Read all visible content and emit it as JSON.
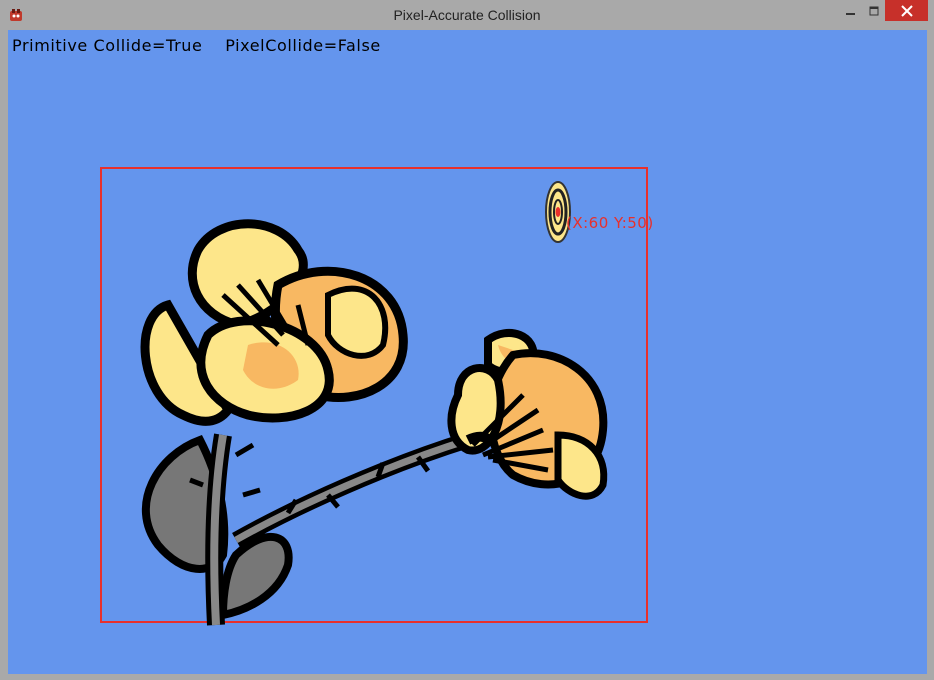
{
  "window": {
    "title": "Pixel-Accurate Collision",
    "titlebar_color": "#a9a9a9",
    "close_button_color": "#c7302a"
  },
  "canvas": {
    "background": "#6495ed"
  },
  "status": {
    "primitive": "Primitive Collide=True",
    "pixel": "PixelCollide=False"
  },
  "bounding_box": {
    "color": "#e8302c"
  },
  "target": {
    "label": "(X:60 Y:50)",
    "label_color": "#e8302c"
  },
  "icons": {
    "app": "app-icon",
    "minimize": "minimize-icon",
    "maximize": "maximize-icon",
    "close": "close-icon",
    "sprite": "flower-sprite",
    "target": "target-sprite"
  }
}
